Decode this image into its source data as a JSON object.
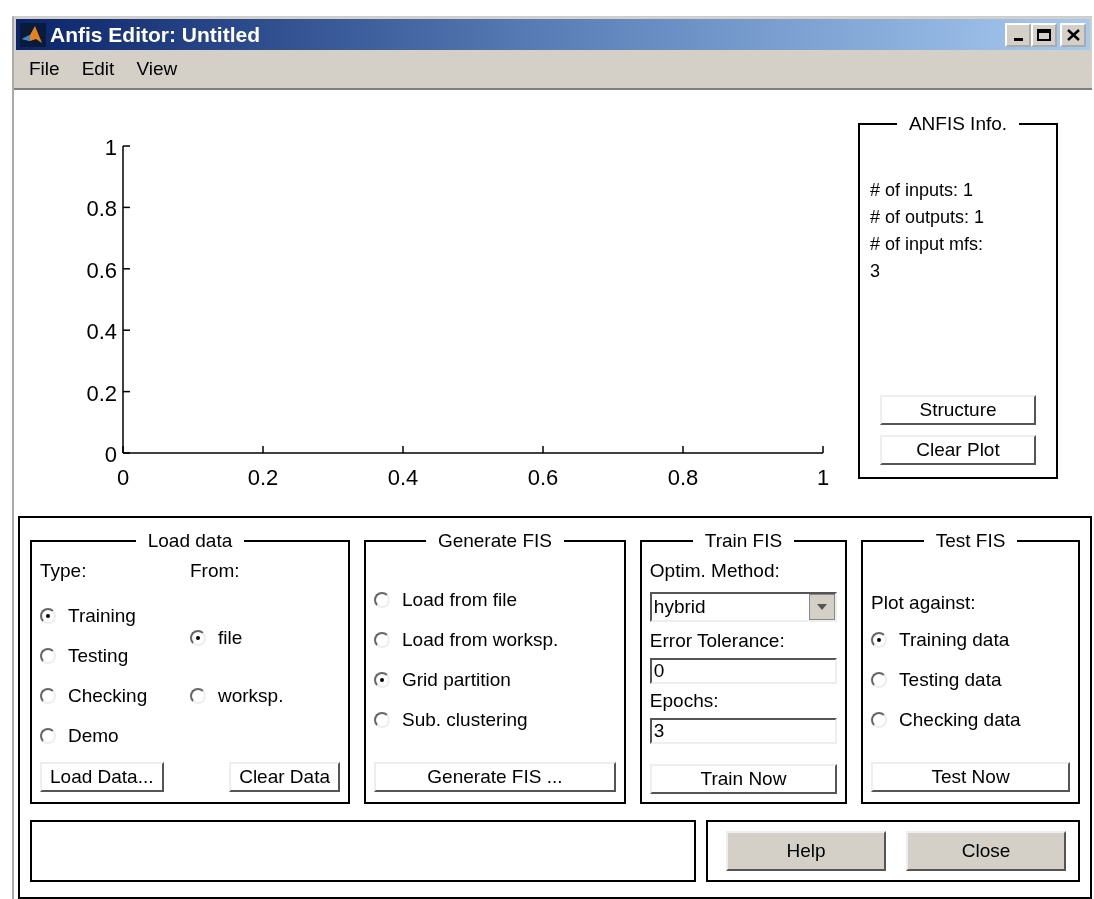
{
  "window": {
    "title": "Anfis Editor: Untitled"
  },
  "menu": [
    "File",
    "Edit",
    "View"
  ],
  "plot": {
    "chart_data": {
      "type": "line",
      "xlim": [
        0,
        1
      ],
      "ylim": [
        0,
        1
      ],
      "xticks": [
        0,
        0.2,
        0.4,
        0.6,
        0.8,
        1
      ],
      "yticks": [
        0,
        0.2,
        0.4,
        0.6,
        0.8,
        1
      ]
    }
  },
  "anfis_info": {
    "title": "ANFIS Info.",
    "lines": [
      "# of inputs: 1",
      "# of outputs: 1",
      "# of input mfs:",
      "3"
    ],
    "buttons": [
      "Structure",
      "Clear Plot"
    ]
  },
  "load_data": {
    "title": "Load data",
    "type_label": "Type:",
    "from_label": "From:",
    "type_options": [
      {
        "label": "Training",
        "selected": true
      },
      {
        "label": "Testing",
        "selected": false
      },
      {
        "label": "Checking",
        "selected": false
      },
      {
        "label": "Demo",
        "selected": false
      }
    ],
    "from_options": [
      {
        "label": "file",
        "selected": true
      },
      {
        "label": "worksp.",
        "selected": false
      }
    ],
    "buttons": [
      "Load Data...",
      "Clear Data"
    ]
  },
  "generate_fis": {
    "title": "Generate FIS",
    "options": [
      {
        "label": "Load from file",
        "selected": false
      },
      {
        "label": "Load from worksp.",
        "selected": false
      },
      {
        "label": "Grid partition",
        "selected": true
      },
      {
        "label": "Sub. clustering",
        "selected": false
      }
    ],
    "button": "Generate FIS ..."
  },
  "train_fis": {
    "title": "Train FIS",
    "method_label": "Optim. Method:",
    "method_value": "hybrid",
    "tolerance_label": "Error Tolerance:",
    "tolerance_value": "0",
    "epochs_label": "Epochs:",
    "epochs_value": "3",
    "button": "Train Now"
  },
  "test_fis": {
    "title": "Test FIS",
    "plot_label": "Plot against:",
    "options": [
      {
        "label": "Training data",
        "selected": true
      },
      {
        "label": "Testing data",
        "selected": false
      },
      {
        "label": "Checking data",
        "selected": false
      }
    ],
    "button": "Test Now"
  },
  "footer": {
    "buttons": [
      "Help",
      "Close"
    ]
  }
}
